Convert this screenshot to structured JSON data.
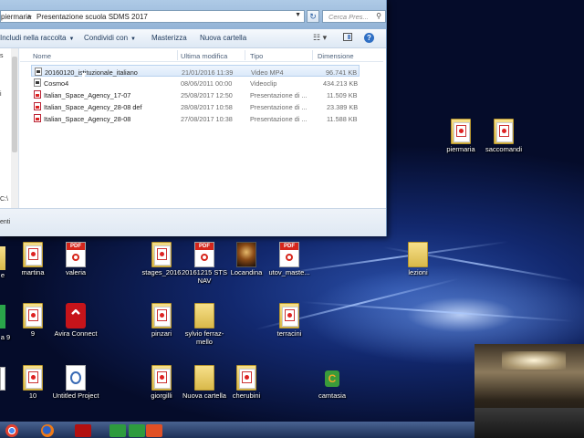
{
  "explorer": {
    "breadcrumb": [
      "piermaria",
      "Presentazione scuola SDMS 2017"
    ],
    "search_placeholder": "Cerca Pres...",
    "toolbar": {
      "include": "Includi nella raccolta",
      "share": "Condividi con",
      "burn": "Masterizza",
      "new_folder": "Nuova cartella"
    },
    "columns": {
      "name": "Nome",
      "modified": "Ultima modifica",
      "type": "Tipo",
      "size": "Dimensione"
    },
    "files": [
      {
        "name": "20160120_istituzionale_italiano",
        "modified": "21/01/2016 11:39",
        "type": "Video MP4",
        "size": "96.741 KB",
        "icon": "video-file-icon"
      },
      {
        "name": "Cosmo4",
        "modified": "08/06/2011 00:00",
        "type": "Videoclip",
        "size": "434.213 KB",
        "icon": "video-file-icon"
      },
      {
        "name": "Italian_Space_Agency_17-07",
        "modified": "25/08/2017 12:50",
        "type": "Presentazione di ...",
        "size": "11.509 KB",
        "icon": "pdf-file-icon"
      },
      {
        "name": "Italian_Space_Agency_28-08 def",
        "modified": "28/08/2017 10:58",
        "type": "Presentazione di ...",
        "size": "23.389 KB",
        "icon": "pdf-file-icon"
      },
      {
        "name": "Italian_Space_Agency_28-08",
        "modified": "27/08/2017 10:38",
        "type": "Presentazione di ...",
        "size": "11.588 KB",
        "icon": "pdf-file-icon"
      }
    ],
    "nav_fragments": [
      "C:\\",
      "enti"
    ]
  },
  "desktop": {
    "icons": [
      {
        "label": "piermaria",
        "kind": "folder-doc"
      },
      {
        "label": "saccomandi",
        "kind": "folder-doc"
      },
      {
        "label": "martina",
        "kind": "folder-doc"
      },
      {
        "label": "valeria",
        "kind": "pdf"
      },
      {
        "label": "stages_2016",
        "kind": "folder-doc"
      },
      {
        "label": "20161215 STS NAV",
        "kind": "pdf"
      },
      {
        "label": "Locandina",
        "kind": "image"
      },
      {
        "label": "utov_maste...",
        "kind": "pdf"
      },
      {
        "label": "lezioni",
        "kind": "folder"
      },
      {
        "label": "9",
        "kind": "folder-doc"
      },
      {
        "label": "Avira Connect",
        "kind": "app"
      },
      {
        "label": "pinzari",
        "kind": "folder-doc"
      },
      {
        "label": "sylvio ferraz-mello",
        "kind": "folder"
      },
      {
        "label": "terracini",
        "kind": "folder-doc"
      },
      {
        "label": "10",
        "kind": "folder-doc"
      },
      {
        "label": "Untitled Project",
        "kind": "project"
      },
      {
        "label": "giorgilli",
        "kind": "folder-doc"
      },
      {
        "label": "Nuova cartella",
        "kind": "folder"
      },
      {
        "label": "cherubini",
        "kind": "folder-doc"
      },
      {
        "label": "camtasia",
        "kind": "app"
      }
    ],
    "edge_labels": [
      "e",
      "a 9"
    ]
  },
  "taskbar": {
    "apps": [
      "chrome-icon",
      "firefox-icon",
      "acrobat-icon",
      "camtasia-icon",
      "camtasia-recorder-icon",
      "presentation-app-icon"
    ]
  }
}
